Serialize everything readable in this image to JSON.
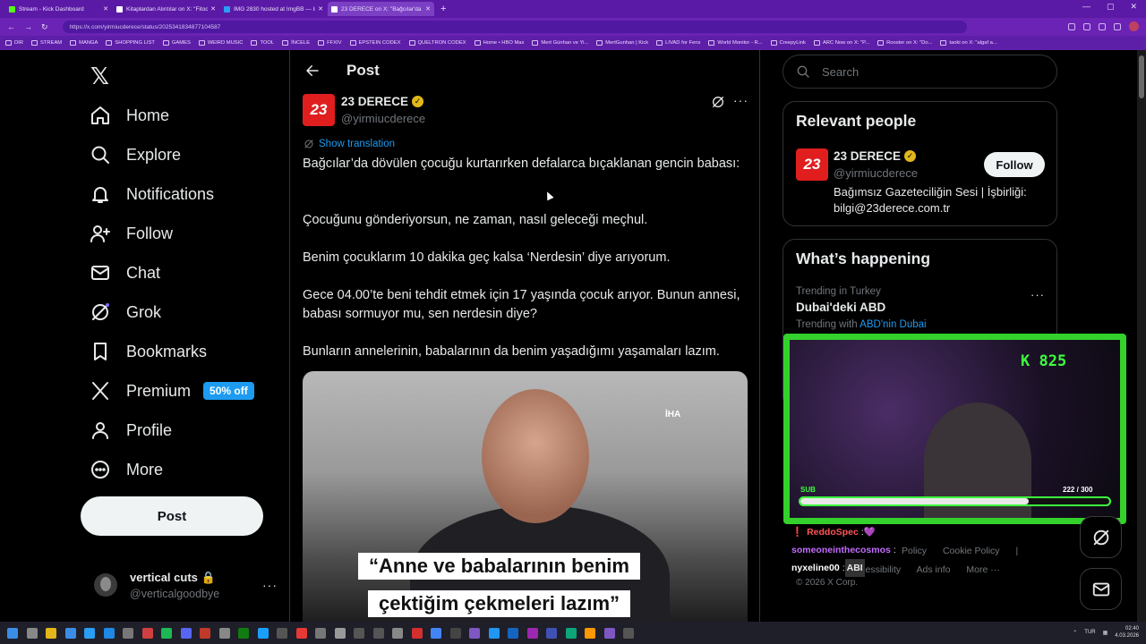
{
  "browser": {
    "tabs": [
      {
        "title": "Stream - Kick Dashboard",
        "fav_color": "#53fc18",
        "active": false
      },
      {
        "title": "Kitaplardan Alıntılar on X: \"Fitoco...",
        "fav_color": "#ffffff",
        "active": false
      },
      {
        "title": "IMG 2830 hosted at ImgBB — Img...",
        "fav_color": "#2a9df4",
        "active": false
      },
      {
        "title": "23 DERECE on X: \"Bağcılar'da döv...",
        "fav_color": "#ffffff",
        "active": true
      }
    ],
    "new_tab": "+",
    "window_controls": [
      "—",
      "▢",
      "✕"
    ],
    "url": "https://x.com/yirmiucderece/status/2025341834877104587",
    "bookmarks": [
      "DIR",
      "STREAM",
      "MANGA",
      "SHOPPING LIST",
      "GAMES",
      "WEIRD MUSIC",
      "TOOL",
      "İNCELE",
      "FFXIV",
      "EPSTEIN CODEX",
      "QUELTRON CODEX",
      "Home • HBO Max",
      "Mert Günhan ve Yi...",
      "MertGunhan | Kick",
      "LIVAD for Fens",
      "World Monitor - R...",
      "CreepyLink",
      "ARC Now on X: \"P...",
      "Rooster on X: \"Do...",
      "taoki on X: \"algaf a..."
    ]
  },
  "sidebar": {
    "logo": "𝕏",
    "items": [
      {
        "label": "Home",
        "icon": "home"
      },
      {
        "label": "Explore",
        "icon": "search"
      },
      {
        "label": "Notifications",
        "icon": "bell"
      },
      {
        "label": "Follow",
        "icon": "person-add"
      },
      {
        "label": "Chat",
        "icon": "mail"
      },
      {
        "label": "Grok",
        "icon": "grok"
      },
      {
        "label": "Bookmarks",
        "icon": "bookmark"
      },
      {
        "label": "Premium",
        "icon": "x"
      },
      {
        "label": "Profile",
        "icon": "person"
      },
      {
        "label": "More",
        "icon": "more-circle"
      }
    ],
    "premium_badge": "50% off",
    "post_button": "Post",
    "account": {
      "name": "vertical cuts 🔒",
      "handle": "@verticalgoodbye",
      "more": "···"
    }
  },
  "main": {
    "header": "Post",
    "author": {
      "avatar_text": "23",
      "name": "23 DERECE",
      "handle": "@yirmiucderece"
    },
    "show_translation": "Show translation",
    "more": "···",
    "paragraphs": [
      "Bağcılar’da dövülen çocuğu kurtarırken defalarca bıçaklanan gencin babası:",
      "Çocuğunu gönderiyorsun, ne zaman, nasıl geleceği meçhul.",
      "Benim çocuklarım 10 dakika geç kalsa ‘Nerdesin’ diye arıyorum.",
      "Gece 04.00’te beni tehdit etmek için 17 yaşında çocuk arıyor. Bunun annesi, babası sormuyor mu, sen nerdesin diye?",
      "Bunların annelerinin, babalarının da benim yaşadığımı yaşamaları lazım."
    ],
    "media": {
      "logo": "İHA",
      "caption_1": "“Anne ve babalarının benim",
      "caption_2": "çektiğim çekmeleri lazım”"
    }
  },
  "right": {
    "search_placeholder": "Search",
    "relevant": {
      "title": "Relevant people",
      "avatar_text": "23",
      "name": "23 DERECE",
      "handle": "@yirmiucderece",
      "bio": "Bağımsız Gazeteciliğin Sesi | İşbirliği: bilgi@23derece.com.tr",
      "follow": "Follow"
    },
    "happening": {
      "title": "What’s happening",
      "context": "Trending in Turkey",
      "trend": "Dubai'deki ABD",
      "with_label": "Trending with",
      "with_link": "ABD'nin Dubai",
      "more": "···"
    },
    "footer": [
      "Policy",
      "Cookie Policy",
      "|",
      "Accessibility",
      "Ads info",
      "More ···"
    ],
    "copyright": "© 2026 X Corp."
  },
  "overlay": {
    "kick_count": "K 825",
    "sub_label": "SUB",
    "sub_current": "222",
    "sub_sep": "/",
    "sub_goal": "300",
    "sub_progress": 0.74,
    "chat": [
      {
        "name": "ReddoSpec",
        "msg": "💜",
        "color": "#ff5555"
      },
      {
        "name": "someoneinthecosmos",
        "msg": "",
        "color": "#c36cff"
      },
      {
        "name": "nyxeline00",
        "msg": "ABI",
        "color": "#ffffff"
      }
    ]
  },
  "taskbar": {
    "lang": "TUR",
    "time": "02:40",
    "date": "4.03.2026"
  }
}
